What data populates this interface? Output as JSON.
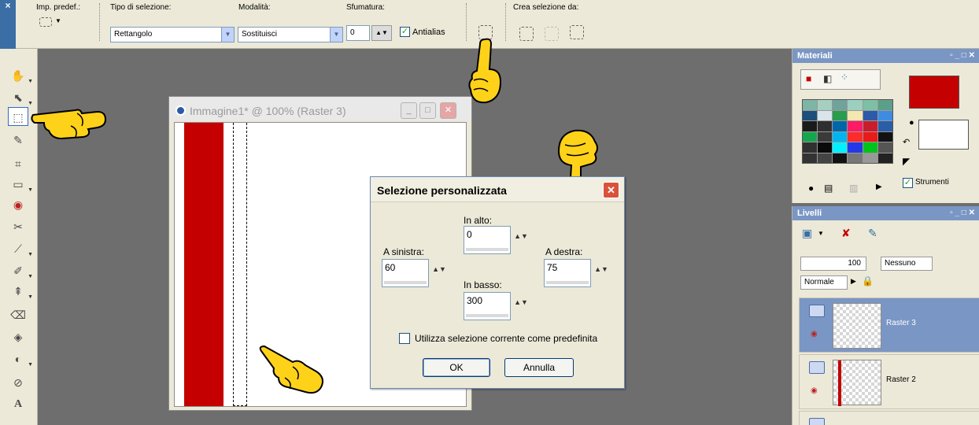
{
  "options_bar": {
    "handle_x": "×",
    "preset_label": "Imp. predef.:",
    "selection_type_label": "Tipo di selezione:",
    "selection_type_value": "Rettangolo",
    "mode_label": "Modalità:",
    "mode_value": "Sostituisci",
    "feather_label": "Sfumatura:",
    "feather_value": "0",
    "antialias_label": "Antialias",
    "create_from_label": "Crea selezione da:"
  },
  "document": {
    "title": "Immagine1* @ 100% (Raster 3)"
  },
  "dialog": {
    "title": "Selezione personalizzata",
    "top_label": "In alto:",
    "top_value": "0",
    "left_label": "A sinistra:",
    "left_value": "60",
    "right_label": "A destra:",
    "right_value": "75",
    "bottom_label": "In basso:",
    "bottom_value": "300",
    "use_current_label": "Utilizza selezione corrente come predefinita",
    "ok_label": "OK",
    "cancel_label": "Annulla"
  },
  "materials_panel": {
    "title": "Materiali",
    "tools_checkbox_label": "Strumenti",
    "foreground_color": "#c40000",
    "background_color": "#ffffff"
  },
  "layers_panel": {
    "title": "Livelli",
    "opacity_value": "100",
    "mask_value": "Nessuno",
    "blend_mode": "Normale",
    "layers": [
      {
        "name": "Raster 3"
      },
      {
        "name": "Raster 2"
      }
    ]
  },
  "colors": {
    "accent": "#7a96c4",
    "red": "#c40000"
  }
}
